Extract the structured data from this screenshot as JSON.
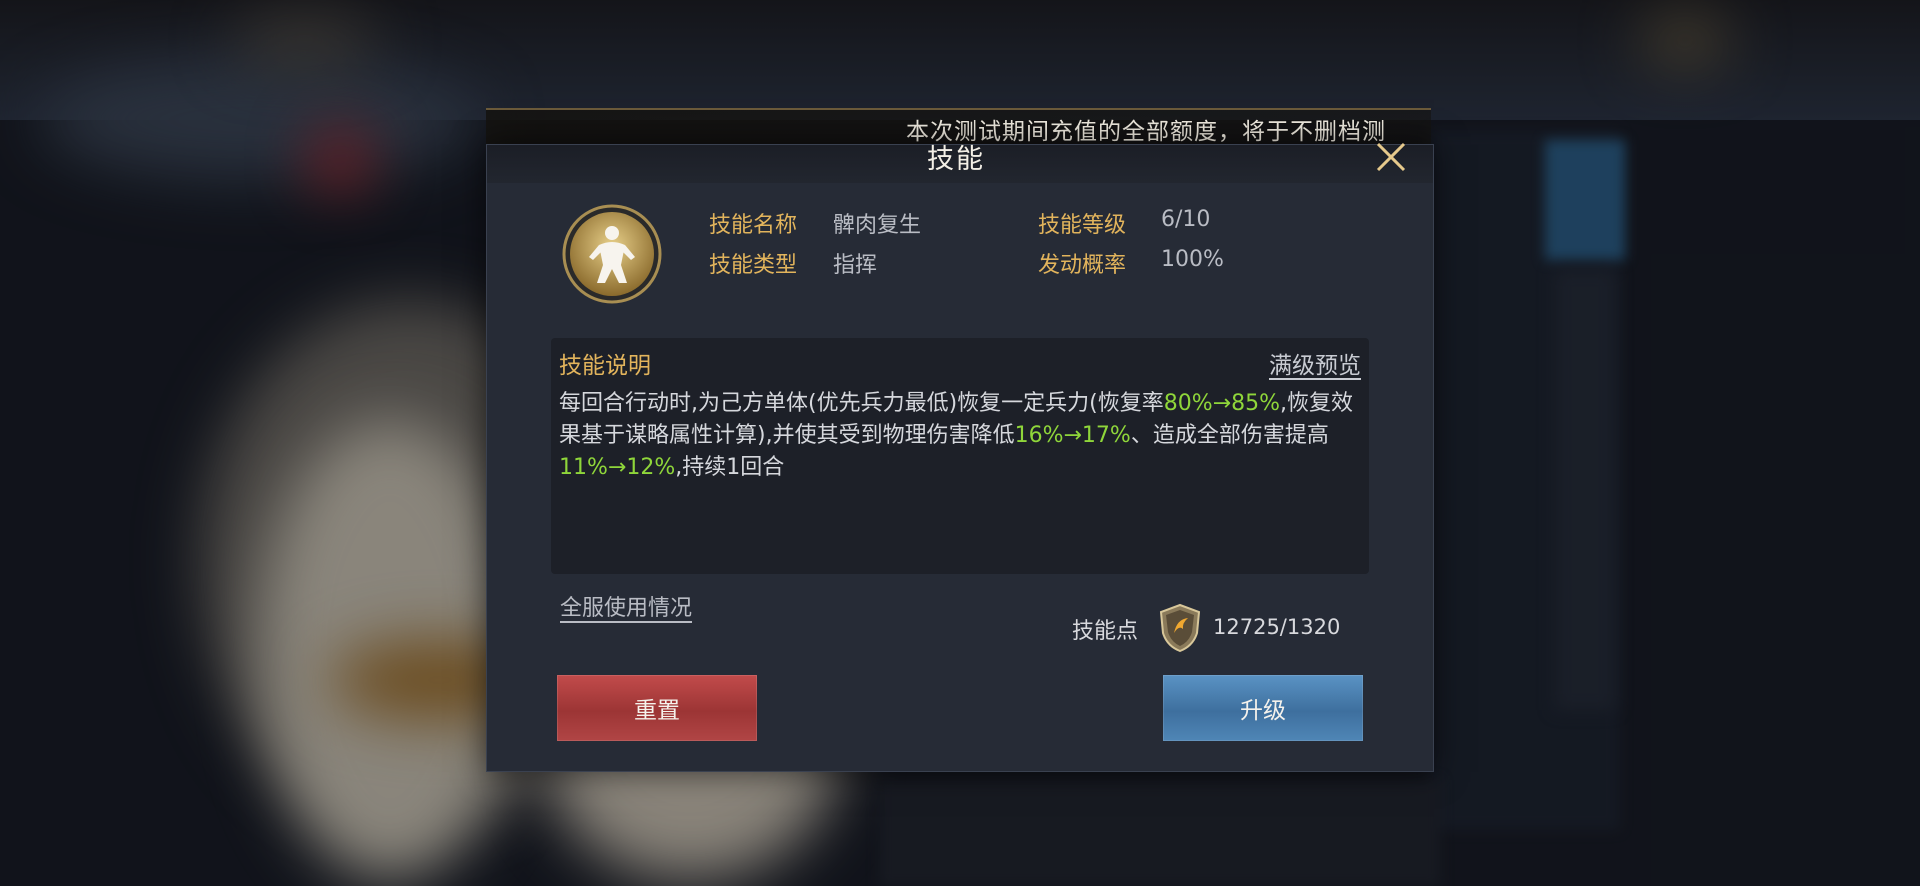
{
  "marquee": {
    "text": "本次测试期间充值的全部额度，将于不删档测"
  },
  "dialog": {
    "title": "技能",
    "skill": {
      "name_label": "技能名称",
      "name_value": "髀肉复生",
      "level_label": "技能等级",
      "level_value": "6/10",
      "type_label": "技能类型",
      "type_value": "指挥",
      "chance_label": "发动概率",
      "chance_value": "100%"
    },
    "description": {
      "title": "技能说明",
      "preview_link": "满级预览",
      "segments": [
        {
          "text": "每回合行动时,为己方单体(优先兵力最低)恢复一定兵力(恢复率",
          "highlight": false
        },
        {
          "text": "80%→85%",
          "highlight": true
        },
        {
          "text": ",恢复效果基于谋略属性计算),并使其受到物理伤害降低",
          "highlight": false
        },
        {
          "text": "16%→17%",
          "highlight": true
        },
        {
          "text": "、造成全部伤害提高",
          "highlight": false
        },
        {
          "text": "11%→12%",
          "highlight": true
        },
        {
          "text": ",持续1回合",
          "highlight": false
        }
      ]
    },
    "usage_link": "全服使用情况",
    "skill_points": {
      "label": "技能点",
      "value": "12725/1320"
    },
    "buttons": {
      "reset": "重置",
      "upgrade": "升级"
    }
  },
  "colors": {
    "label_gold": "#e2b45c",
    "highlight_green": "#8fd63a",
    "reset_red": "#b14545",
    "upgrade_blue": "#4f86b6"
  }
}
